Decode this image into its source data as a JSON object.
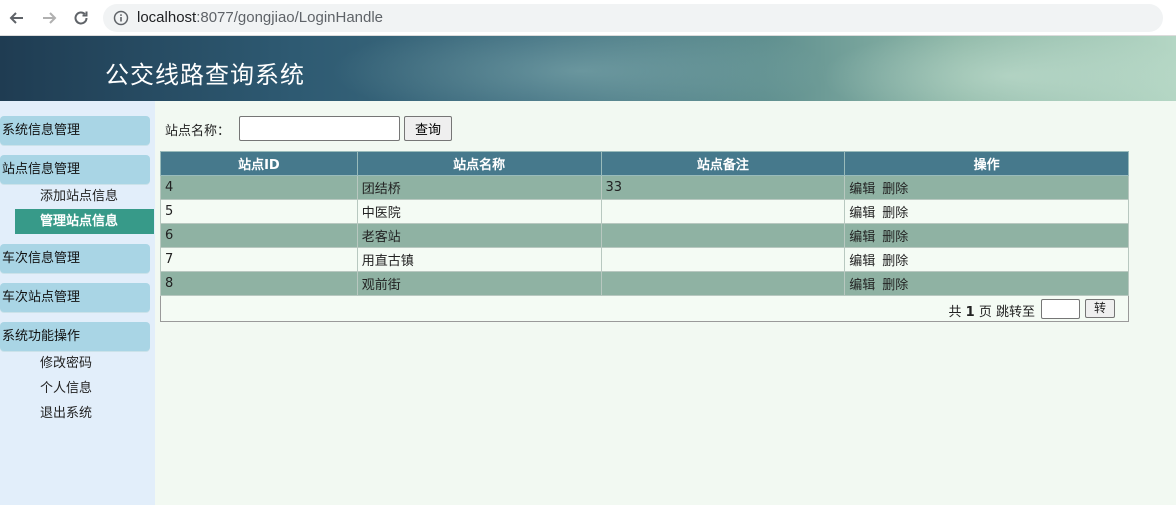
{
  "browser": {
    "url_host": "localhost",
    "url_rest": ":8077/gongjiao/LoginHandle"
  },
  "header": {
    "title": "公交线路查询系统"
  },
  "sidebar": {
    "groups": [
      {
        "title": "系统信息管理"
      },
      {
        "title": "站点信息管理",
        "items": [
          {
            "label": "添加站点信息"
          },
          {
            "label": "管理站点信息",
            "active": true
          }
        ]
      },
      {
        "title": "车次信息管理"
      },
      {
        "title": "车次站点管理"
      },
      {
        "title": "系统功能操作",
        "items": [
          {
            "label": "修改密码"
          },
          {
            "label": "个人信息"
          },
          {
            "label": "退出系统"
          }
        ]
      }
    ]
  },
  "search": {
    "label": "站点名称：",
    "value": "",
    "button": "查询"
  },
  "table": {
    "headers": [
      "站点ID",
      "站点名称",
      "站点备注",
      "操作"
    ],
    "rows": [
      {
        "id": "4",
        "name": "团结桥",
        "note": "33"
      },
      {
        "id": "5",
        "name": "中医院",
        "note": ""
      },
      {
        "id": "6",
        "name": "老客站",
        "note": ""
      },
      {
        "id": "7",
        "name": "用直古镇",
        "note": ""
      },
      {
        "id": "8",
        "name": "观前街",
        "note": ""
      }
    ],
    "edit_label": "编辑",
    "delete_label": "删除"
  },
  "pager": {
    "prefix": "共",
    "total_pages": "1",
    "middle": "页 跳转至",
    "go_button": "转"
  }
}
